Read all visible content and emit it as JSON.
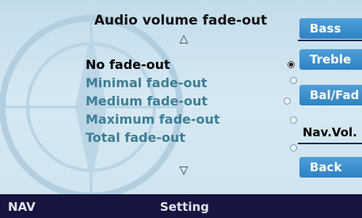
{
  "screen": {
    "title": "Audio volume fade-out",
    "scroll_up_glyph": "△",
    "scroll_down_glyph": "▽"
  },
  "options": [
    {
      "label": "No fade-out",
      "selected": true
    },
    {
      "label": "Minimal fade-out",
      "selected": false
    },
    {
      "label": "Medium fade-out",
      "selected": false
    },
    {
      "label": "Maximum fade-out",
      "selected": false
    },
    {
      "label": "Total fade-out",
      "selected": false
    }
  ],
  "side_menu": {
    "bass": "Bass",
    "treble": "Treble",
    "bal_fad": "Bal/Fad",
    "nav_vol": "Nav.Vol.",
    "back": "Back"
  },
  "bottom_bar": {
    "left": "NAV",
    "center": "Setting"
  },
  "colors": {
    "background": "#c9e0ec",
    "button": "#3a8ccc",
    "bottom_bar": "#15153f",
    "inactive_option": "#3c7e96"
  }
}
